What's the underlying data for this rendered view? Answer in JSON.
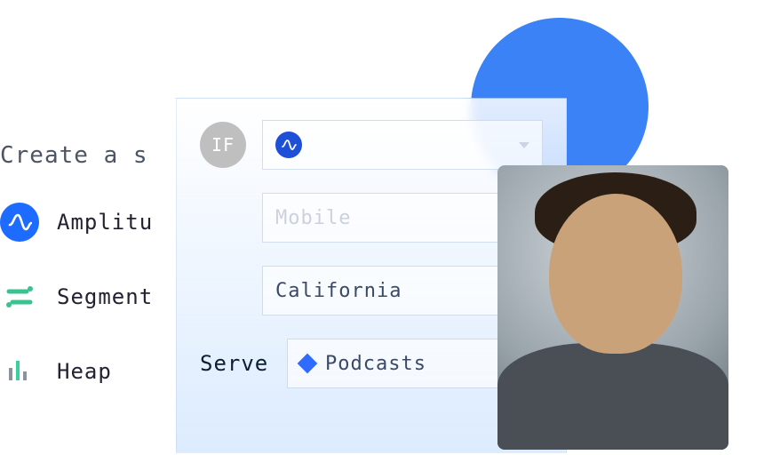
{
  "left": {
    "title": "Create a s",
    "providers": [
      {
        "label": "Amplitu",
        "icon": "amplitude-icon"
      },
      {
        "label": "Segment",
        "icon": "segment-icon"
      },
      {
        "label": "Heap",
        "icon": "heap-icon"
      }
    ]
  },
  "card": {
    "if_label": "IF",
    "serve_label": "Serve",
    "selects": {
      "source": {
        "value": "",
        "has_amp_badge": true
      },
      "device": {
        "value": "Mobile"
      },
      "region": {
        "value": "California"
      },
      "content": {
        "value": "Podcasts",
        "has_diamond": true
      }
    }
  }
}
